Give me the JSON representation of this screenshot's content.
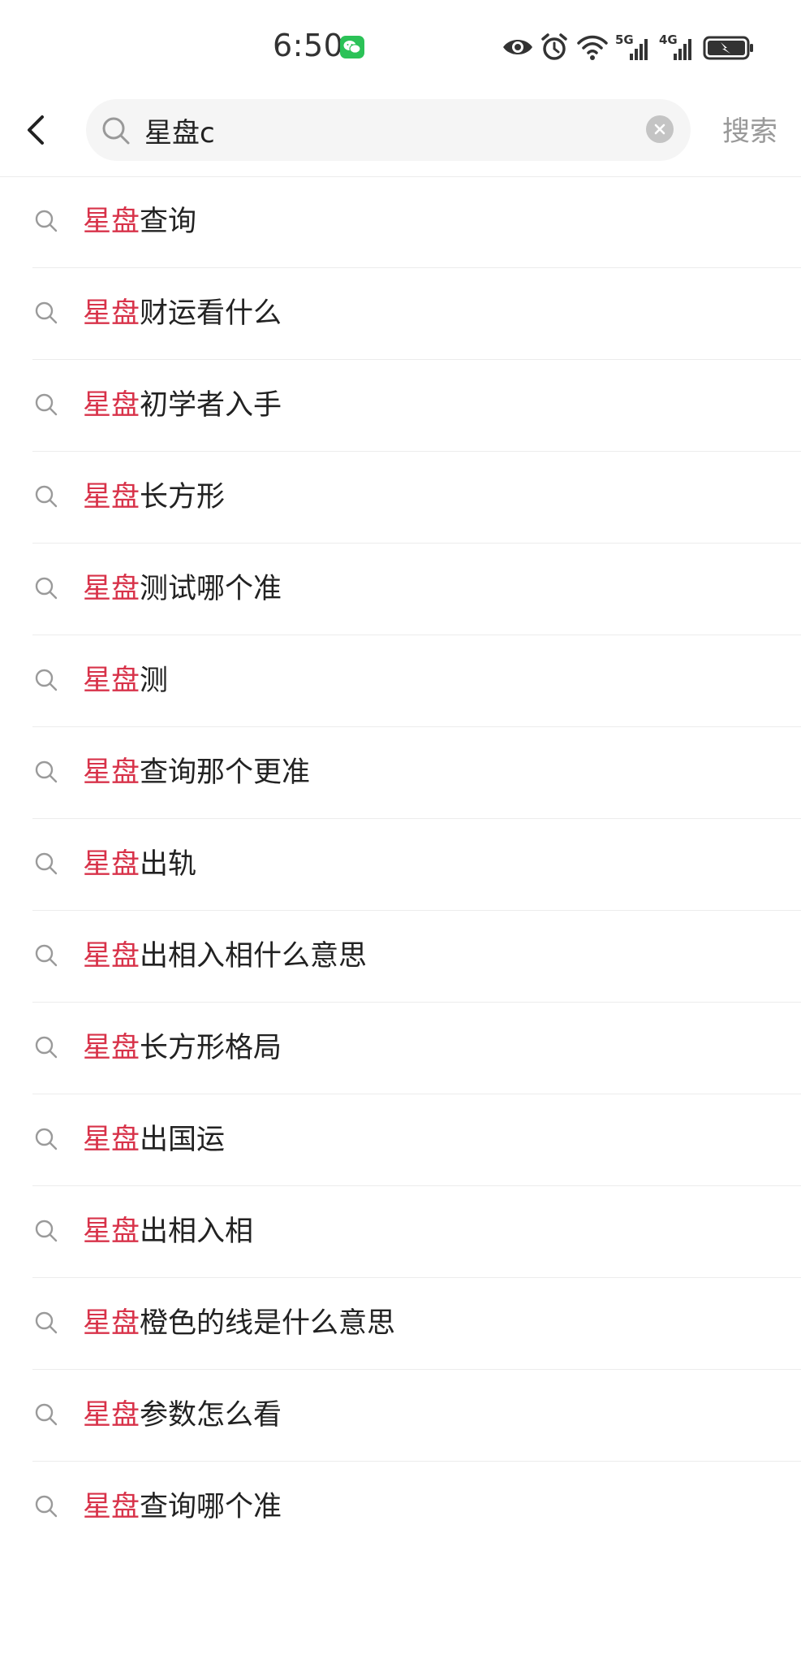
{
  "status_bar": {
    "time": "6:50",
    "notification_icon": "wechat-icon",
    "icons": [
      "eye-icon",
      "alarm-icon",
      "wifi-icon",
      "signal-5g-icon",
      "signal-4g-icon",
      "battery-charging-icon"
    ],
    "network_1": "5G",
    "network_2": "4G"
  },
  "header": {
    "back_icon": "back-arrow-icon",
    "search": {
      "value": "星盘c",
      "search_icon": "search-icon",
      "clear_icon": "clear-icon"
    },
    "search_button_label": "搜索"
  },
  "colors": {
    "highlight": "#d8334a",
    "text": "#222222",
    "divider": "#ececec",
    "search_bg": "#f5f5f5",
    "muted": "#999999"
  },
  "suggestions": [
    {
      "highlight": "星盘",
      "rest": "查询"
    },
    {
      "highlight": "星盘",
      "rest": "财运看什么"
    },
    {
      "highlight": "星盘",
      "rest": "初学者入手"
    },
    {
      "highlight": "星盘",
      "rest": "长方形"
    },
    {
      "highlight": "星盘",
      "rest": "测试哪个准"
    },
    {
      "highlight": "星盘",
      "rest": "测"
    },
    {
      "highlight": "星盘",
      "rest": "查询那个更准"
    },
    {
      "highlight": "星盘",
      "rest": "出轨"
    },
    {
      "highlight": "星盘",
      "rest": "出相入相什么意思"
    },
    {
      "highlight": "星盘",
      "rest": "长方形格局"
    },
    {
      "highlight": "星盘",
      "rest": "出国运"
    },
    {
      "highlight": "星盘",
      "rest": "出相入相"
    },
    {
      "highlight": "星盘",
      "rest": "橙色的线是什么意思"
    },
    {
      "highlight": "星盘",
      "rest": "参数怎么看"
    },
    {
      "highlight": "星盘",
      "rest": "查询哪个准"
    }
  ]
}
